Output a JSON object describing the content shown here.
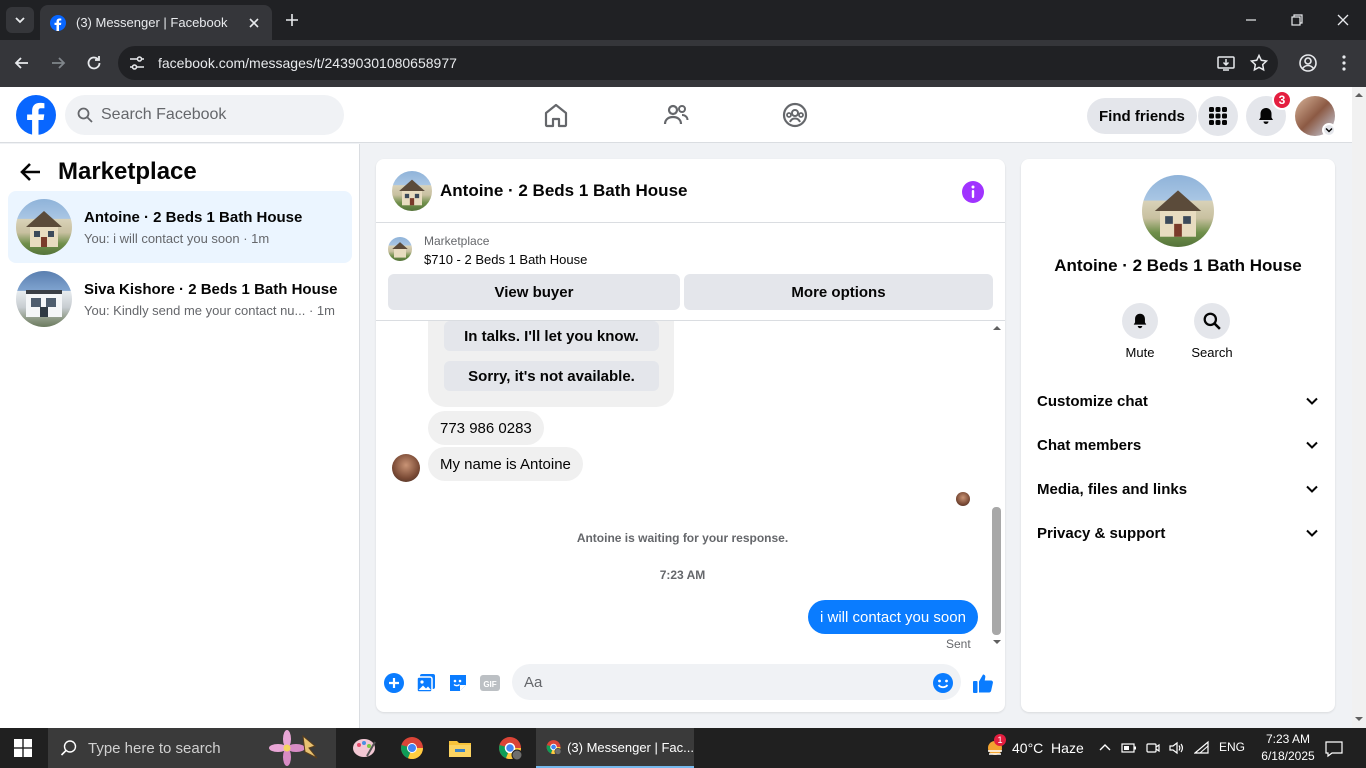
{
  "browser": {
    "tab_title": "(3) Messenger | Facebook",
    "url": "facebook.com/messages/t/24390301080658977"
  },
  "fb_header": {
    "search_placeholder": "Search Facebook",
    "find_friends": "Find friends",
    "notification_count": "3"
  },
  "sidebar": {
    "title": "Marketplace",
    "conversations": [
      {
        "name": "Antoine · 2 Beds 1 Bath House",
        "preview": "You: i will contact you soon · 1m",
        "active": true
      },
      {
        "name": "Siva Kishore · 2 Beds 1 Bath House",
        "preview": "You: Kindly send me your contact nu... · 1m",
        "active": false
      }
    ]
  },
  "chat": {
    "title": "Antoine · 2 Beds 1 Bath House",
    "marketplace_label": "Marketplace",
    "listing": "$710 - 2 Beds 1 Bath House",
    "view_buyer": "View buyer",
    "more_options": "More options",
    "quick_replies": [
      "In talks. I'll let you know.",
      "Sorry, it's not available."
    ],
    "messages_in": [
      "773 986 0283",
      "My name is Antoine"
    ],
    "waiting_notice": "Antoine is waiting for your response.",
    "timestamp": "7:23 AM",
    "message_out": "i will contact you soon",
    "sent_label": "Sent",
    "composer_placeholder": "Aa"
  },
  "info_panel": {
    "name": "Antoine · 2 Beds 1 Bath House",
    "mute": "Mute",
    "search": "Search",
    "sections": [
      "Customize chat",
      "Chat members",
      "Media, files and links",
      "Privacy & support"
    ]
  },
  "taskbar": {
    "search_placeholder": "Type here to search",
    "active_app": "(3) Messenger | Fac...",
    "weather": "40°C  Haze",
    "weather_badge": "1",
    "language": "ENG",
    "time": "7:23 AM",
    "date": "6/18/2025"
  },
  "colors": {
    "fb_blue": "#0866ff",
    "messenger_blue": "#0a7cff",
    "info_purple": "#a033ff",
    "badge_red": "#e41e3f"
  }
}
